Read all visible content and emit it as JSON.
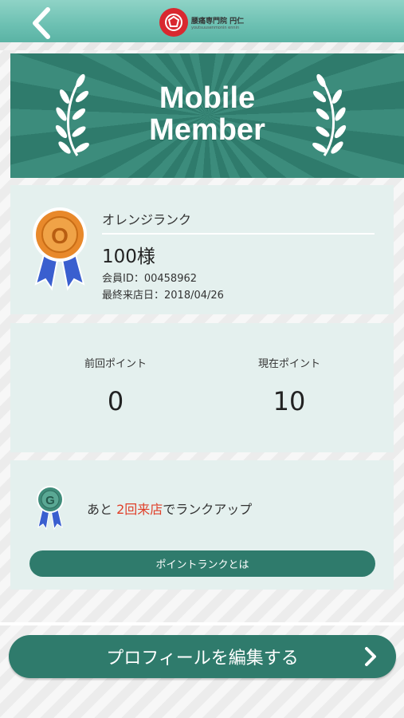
{
  "header": {
    "back_icon": "chevron-left-icon",
    "logo_name": "腰痛専門院 円仁",
    "logo_sub": "youtsuusenmonin ennin"
  },
  "banner": {
    "title_line1": "Mobile",
    "title_line2": "Member"
  },
  "member": {
    "rank_name": "オレンジランク",
    "name": "100様",
    "member_id": "会員ID：00458962",
    "last_visit": "最終来店日：2018/04/26",
    "medal_letter": "O"
  },
  "points": {
    "prev_label": "前回ポイント",
    "prev_value": "0",
    "current_label": "現在ポイント",
    "current_value": "10"
  },
  "rankup": {
    "medal_letter": "G",
    "text_before": "あと ",
    "text_highlight": "2回来店",
    "text_after": "でランクアップ",
    "button_label": "ポイントランクとは"
  },
  "footer": {
    "edit_label": "プロフィールを編集する"
  },
  "colors": {
    "accent": "#2f7b6c",
    "header": "#6cc0b2",
    "card": "#e4f0ee",
    "highlight": "#e0402a",
    "orange_medal": "#e8892b",
    "ribbon": "#3a5fcf"
  }
}
